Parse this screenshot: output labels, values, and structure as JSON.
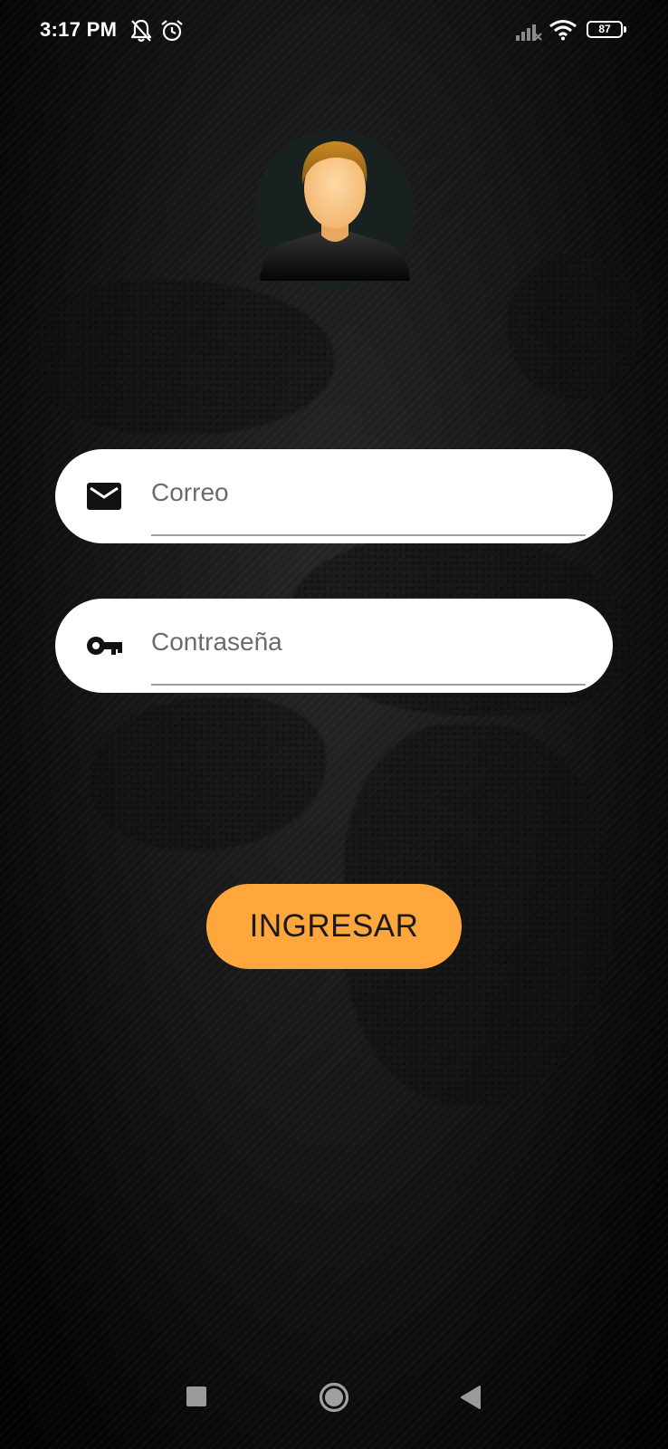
{
  "status_bar": {
    "time": "3:17 PM",
    "battery_level": "87",
    "icons": [
      "bell-off-icon",
      "alarm-icon",
      "signal-icon",
      "wifi-icon",
      "battery-icon"
    ]
  },
  "login": {
    "email_field": {
      "placeholder": "Correo",
      "value": "",
      "icon": "email-icon"
    },
    "password_field": {
      "placeholder": "Contraseña",
      "value": "",
      "icon": "key-icon"
    },
    "submit_label": "INGRESAR"
  },
  "colors": {
    "accent": "#ffa73c",
    "background": "#111111",
    "field_background": "#ffffff"
  },
  "nav_bar": {
    "icons": [
      "recents-icon",
      "home-icon",
      "back-icon"
    ]
  }
}
